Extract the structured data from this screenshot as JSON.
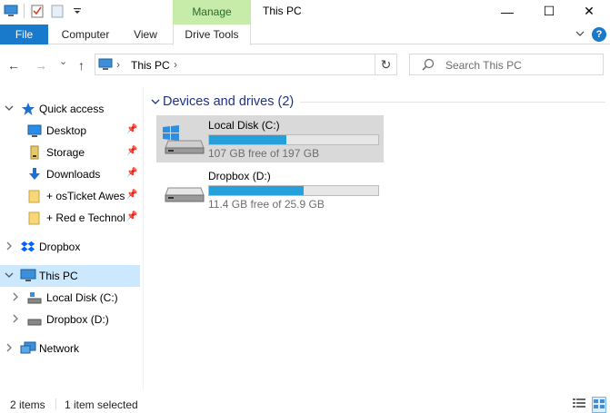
{
  "titlebar": {
    "manage_label": "Manage",
    "window_title": "This PC",
    "minimize": "—",
    "maximize": "☐",
    "close": "✕"
  },
  "ribbon": {
    "tabs": [
      {
        "label": "File"
      },
      {
        "label": "Computer"
      },
      {
        "label": "View"
      },
      {
        "label": "Drive Tools"
      }
    ],
    "expand_icon": "chevron-down-icon",
    "help_label": "?"
  },
  "address": {
    "back": "←",
    "forward": "→",
    "recent": "⌄",
    "up": "↑",
    "crumb_sep": "›",
    "path": "This PC",
    "refresh": "↻",
    "search_placeholder": "Search This PC"
  },
  "sidebar": {
    "items": [
      {
        "label": "Quick access",
        "icon": "star-icon"
      },
      {
        "label": "Desktop",
        "icon": "desktop-icon",
        "pinned": true
      },
      {
        "label": "Storage",
        "icon": "storage-icon",
        "pinned": true
      },
      {
        "label": "Downloads",
        "icon": "download-icon",
        "pinned": true
      },
      {
        "label": "+ osTicket Awesome",
        "icon": "folder-icon",
        "pinned": true
      },
      {
        "label": "+ Red e Technologies",
        "icon": "folder-icon",
        "pinned": true
      },
      {
        "label": "Dropbox",
        "icon": "dropbox-icon"
      },
      {
        "label": "This PC",
        "icon": "computer-icon"
      },
      {
        "label": "Local Disk (C:)",
        "icon": "disk-icon"
      },
      {
        "label": "Dropbox (D:)",
        "icon": "disk-icon"
      },
      {
        "label": "Network",
        "icon": "network-icon"
      }
    ]
  },
  "content": {
    "group_title": "Devices and drives (2)",
    "drives": [
      {
        "name": "Local Disk (C:)",
        "free_text": "107 GB free of 197 GB",
        "used_fraction": 0.457
      },
      {
        "name": "Dropbox (D:)",
        "free_text": "11.4 GB free of 25.9 GB",
        "used_fraction": 0.56
      }
    ]
  },
  "status": {
    "items": "2 items",
    "selection": "1 item selected"
  },
  "colors": {
    "accent": "#1979ca",
    "manage": "#c7eba8",
    "selected": "#cce8ff",
    "bar": "#26a0da"
  }
}
